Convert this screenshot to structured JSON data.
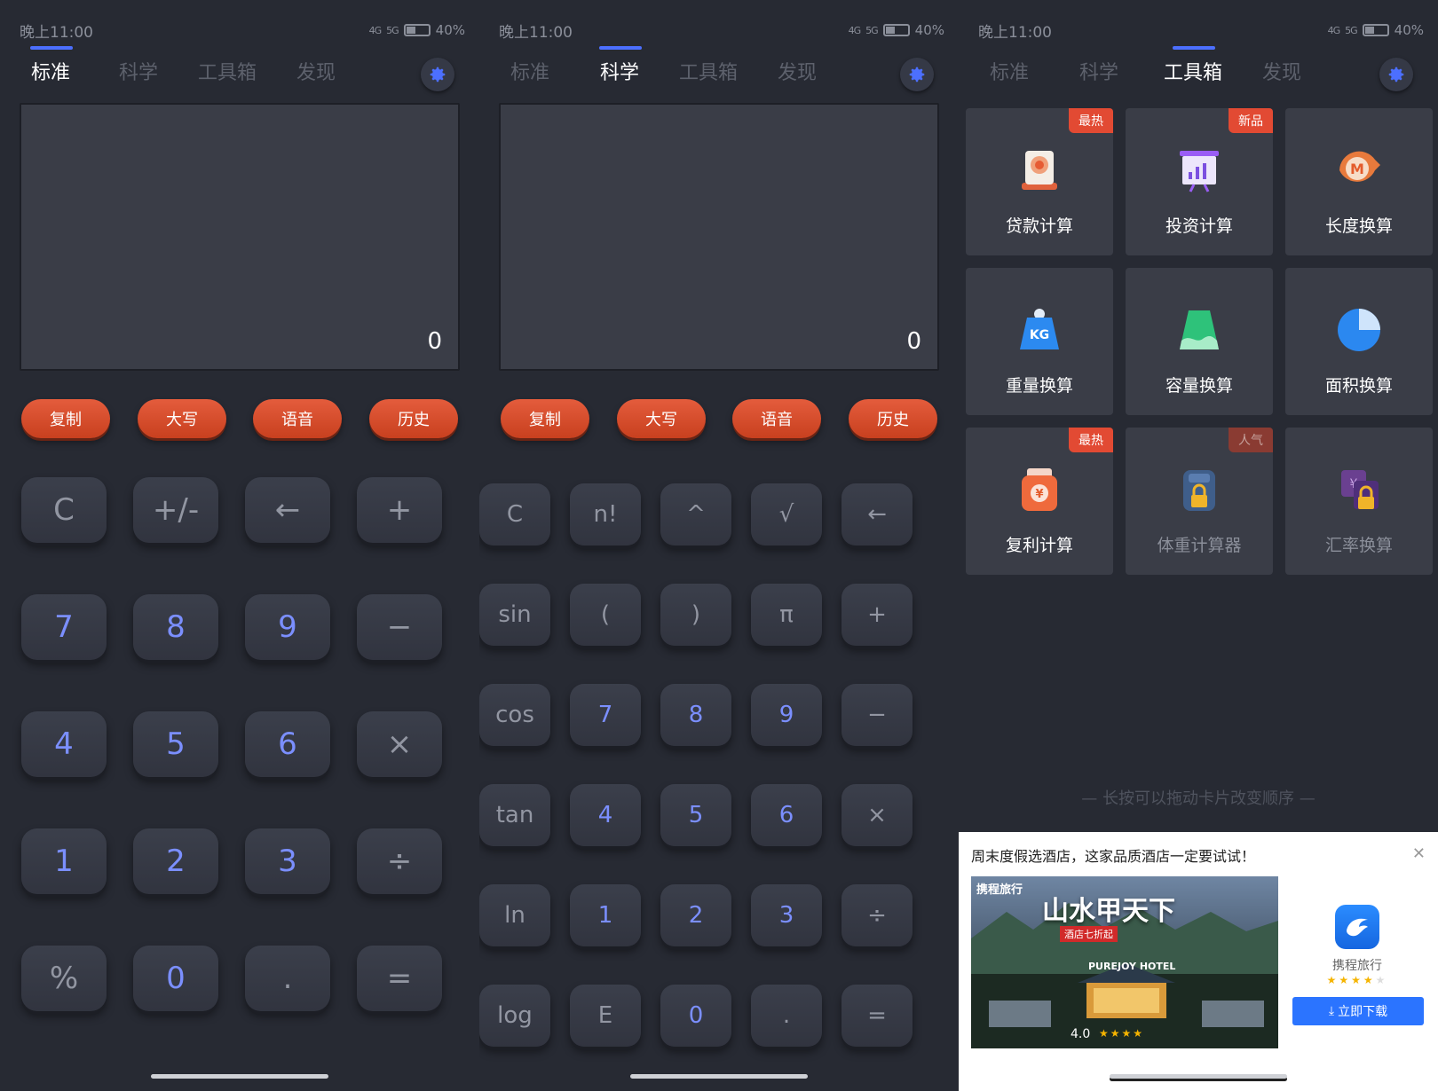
{
  "status_bar": {
    "time": "晚上11:00",
    "battery": "40%",
    "network_1": "4G",
    "network_2": "5G"
  },
  "tabs": [
    "标准",
    "科学",
    "工具箱",
    "发现"
  ],
  "colors": {
    "accent": "#4c6fff",
    "action": "#d14a2a",
    "bg": "#272a33",
    "key_num": "#7b8fff"
  },
  "display_value": "0",
  "actions": [
    "复制",
    "大写",
    "语音",
    "历史"
  ],
  "standard_keys": [
    "C",
    "+/-",
    "←",
    "+",
    "7",
    "8",
    "9",
    "−",
    "4",
    "5",
    "6",
    "×",
    "1",
    "2",
    "3",
    "÷",
    "%",
    "0",
    ".",
    "="
  ],
  "science_keys": [
    "C",
    "n!",
    "^",
    "√",
    "←",
    "sin",
    "(",
    ")",
    "π",
    "+",
    "cos",
    "7",
    "8",
    "9",
    "−",
    "tan",
    "4",
    "5",
    "6",
    "×",
    "ln",
    "1",
    "2",
    "3",
    "÷",
    "log",
    "E",
    "0",
    ".",
    "="
  ],
  "tools": [
    {
      "label": "贷款计算",
      "badge": "最热",
      "icon": "loan-icon",
      "locked": false
    },
    {
      "label": "投资计算",
      "badge": "新品",
      "icon": "investment-icon",
      "locked": false
    },
    {
      "label": "长度换算",
      "badge": "",
      "icon": "length-icon",
      "locked": false
    },
    {
      "label": "重量换算",
      "badge": "",
      "icon": "weight-icon",
      "locked": false
    },
    {
      "label": "容量换算",
      "badge": "",
      "icon": "volume-icon",
      "locked": false
    },
    {
      "label": "面积换算",
      "badge": "",
      "icon": "area-icon",
      "locked": false
    },
    {
      "label": "复利计算",
      "badge": "最热",
      "icon": "compound-interest-icon",
      "locked": false
    },
    {
      "label": "体重计算器",
      "badge": "人气",
      "icon": "body-weight-icon",
      "locked": true
    },
    {
      "label": "汇率换算",
      "badge": "",
      "icon": "exchange-rate-icon",
      "locked": true
    }
  ],
  "drag_hint": "— 长按可以拖动卡片改变顺序 —",
  "ad": {
    "title": "周末度假选酒店，这家品质酒店一定要试试！",
    "brand": "携程旅行",
    "headline": "山水甲天下",
    "promo": "酒店七折起",
    "hotel": "PUREJOY HOTEL",
    "rating": "4.0",
    "app_name": "携程旅行",
    "download_label": "立即下载"
  }
}
